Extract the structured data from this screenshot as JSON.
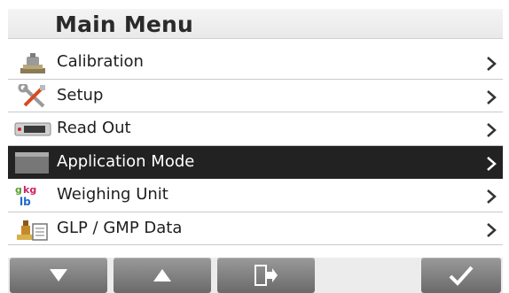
{
  "header": {
    "title": "Main Menu"
  },
  "menu": {
    "items": [
      {
        "label": "Calibration",
        "icon": "calibration-weight-icon",
        "selected": false
      },
      {
        "label": "Setup",
        "icon": "setup-tools-icon",
        "selected": false
      },
      {
        "label": "Read Out",
        "icon": "readout-display-icon",
        "selected": false
      },
      {
        "label": "Application Mode",
        "icon": "application-mode-icon",
        "selected": true
      },
      {
        "label": "Weighing Unit",
        "icon": "weighing-unit-icon",
        "selected": false
      },
      {
        "label": "GLP / GMP Data",
        "icon": "glp-gmp-stamp-icon",
        "selected": false
      }
    ]
  },
  "softkeys": {
    "keys": [
      {
        "icon": "arrow-down-icon"
      },
      {
        "icon": "arrow-up-icon"
      },
      {
        "icon": "exit-icon"
      },
      {
        "icon": "checkmark-icon"
      }
    ]
  },
  "colors": {
    "selected_row": "#222222",
    "key": "#7d7d7d",
    "accent": "#cc2222"
  },
  "weighing_unit_icon_text": {
    "g": "g",
    "kg": "kg",
    "lb": "lb"
  }
}
